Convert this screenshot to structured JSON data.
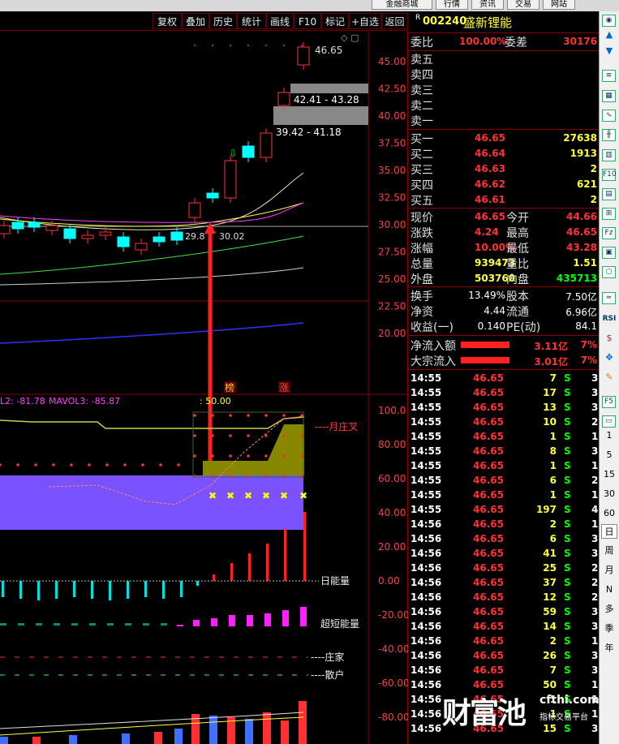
{
  "top_menu": [
    "金融商城",
    "行情",
    "资讯",
    "交易",
    "网站"
  ],
  "toolbar": [
    "复权",
    "叠加",
    "历史",
    "统计",
    "画线",
    "F10",
    "标记",
    "+自选",
    "返回"
  ],
  "stock": {
    "r_flag": "R",
    "code": "002240",
    "name": "盛新锂能"
  },
  "order_book": {
    "wei_bi_label": "委比",
    "wei_bi": "100.00%",
    "wei_cha_label": "委差",
    "wei_cha": "30176",
    "sells": [
      {
        "label": "卖五"
      },
      {
        "label": "卖四"
      },
      {
        "label": "卖三"
      },
      {
        "label": "卖二"
      },
      {
        "label": "卖一"
      }
    ],
    "buys": [
      {
        "label": "买一",
        "price": "46.65",
        "vol": "27638"
      },
      {
        "label": "买二",
        "price": "46.64",
        "vol": "1913"
      },
      {
        "label": "买三",
        "price": "46.63",
        "vol": "2"
      },
      {
        "label": "买四",
        "price": "46.62",
        "vol": "621"
      },
      {
        "label": "买五",
        "price": "46.61",
        "vol": "2"
      }
    ]
  },
  "quote": [
    {
      "l1": "现价",
      "v1": "46.65",
      "l2": "今开",
      "v2": "44.66"
    },
    {
      "l1": "涨跌",
      "v1": "4.24",
      "l2": "最高",
      "v2": "46.65"
    },
    {
      "l1": "涨幅",
      "v1": "10.00%",
      "l2": "最低",
      "v2": "43.28"
    },
    {
      "l1": "总量",
      "v1": "939473",
      "l2": "量比",
      "v2": "1.51"
    },
    {
      "l1": "外盘",
      "v1": "503760",
      "l2": "内盘",
      "v2": "435713"
    }
  ],
  "stats": [
    {
      "l1": "换手",
      "v1": "13.49%",
      "l2": "股本",
      "v2": "7.50亿"
    },
    {
      "l1": "净资",
      "v1": "4.44",
      "l2": "流通",
      "v2": "6.96亿"
    },
    {
      "l1": "收益(一)",
      "v1": "0.140",
      "l2": "PE(动)",
      "v2": "84.1"
    }
  ],
  "flows": [
    {
      "label": "净流入额",
      "value": "3.11亿",
      "pct": "7%"
    },
    {
      "label": "大宗流入",
      "value": "3.01亿",
      "pct": "7%"
    }
  ],
  "ticks": [
    [
      "14:55",
      "46.65",
      "7",
      "S",
      "3"
    ],
    [
      "14:55",
      "46.65",
      "17",
      "S",
      "3"
    ],
    [
      "14:55",
      "46.65",
      "13",
      "S",
      "3"
    ],
    [
      "14:55",
      "46.65",
      "10",
      "S",
      "2"
    ],
    [
      "14:55",
      "46.65",
      "1",
      "S",
      "1"
    ],
    [
      "14:55",
      "46.65",
      "8",
      "S",
      "3"
    ],
    [
      "14:55",
      "46.65",
      "1",
      "S",
      "1"
    ],
    [
      "14:55",
      "46.65",
      "6",
      "S",
      "2"
    ],
    [
      "14:55",
      "46.65",
      "1",
      "S",
      "1"
    ],
    [
      "14:55",
      "46.65",
      "197",
      "S",
      "4"
    ],
    [
      "14:56",
      "46.65",
      "2",
      "S",
      "1"
    ],
    [
      "14:56",
      "46.65",
      "6",
      "S",
      "3"
    ],
    [
      "14:56",
      "46.65",
      "41",
      "S",
      "3"
    ],
    [
      "14:56",
      "46.65",
      "25",
      "S",
      "2"
    ],
    [
      "14:56",
      "46.65",
      "37",
      "S",
      "2"
    ],
    [
      "14:56",
      "46.65",
      "12",
      "S",
      "2"
    ],
    [
      "14:56",
      "46.65",
      "59",
      "S",
      "3"
    ],
    [
      "14:56",
      "46.65",
      "14",
      "S",
      "3"
    ],
    [
      "14:56",
      "46.65",
      "2",
      "S",
      "1"
    ],
    [
      "14:56",
      "46.65",
      "26",
      "S",
      "3"
    ],
    [
      "14:56",
      "46.65",
      "7",
      "S",
      "3"
    ],
    [
      "14:56",
      "46.65",
      "50",
      "S",
      "1"
    ],
    [
      "14:56",
      "46.65",
      "1",
      "S",
      "1"
    ],
    [
      "14:56",
      "46.65",
      "1",
      "S",
      "1"
    ],
    [
      "14:56",
      "46.65",
      "15",
      "S",
      "3"
    ]
  ],
  "price_axis": [
    "45.00",
    "42.50",
    "40.00",
    "37.50",
    "35.00",
    "32.50",
    "30.00",
    "27.50",
    "25.00",
    "22.50",
    "20.00"
  ],
  "ind_axis": [
    "100.0",
    "80.00",
    "60.00",
    "40.00",
    "20.00",
    "0.00",
    "-20.00",
    "-40.00",
    "-60.00",
    "-80.00"
  ],
  "annotations": {
    "high": "46.65",
    "zone1": "42.41 - 43.28",
    "zone2": "39.42 - 41.18",
    "low_label": "29.8",
    "low_label2": "30.02",
    "bang": "榜",
    "zhang": "涨",
    "ind_header1": "L2: -81.78",
    "ind_header2": "MAVOL3: -85.87",
    "ind_header3": ": 50.00",
    "yue_zhuang": "----月庄叉",
    "ri_neng": "日能量",
    "chao_duan": "超短能量",
    "zhuang": "----庄家",
    "san": "----散户"
  },
  "side_tools": [
    "1",
    "5",
    "15",
    "30",
    "60",
    "日",
    "周",
    "月",
    "N",
    "多",
    "季",
    "年"
  ],
  "side_icons": [
    "F10",
    "Fz",
    "RSI"
  ],
  "watermark": {
    "cn": "财富池",
    "site": "cfthi.com",
    "sub": "指标交易平台"
  },
  "colors": {
    "up": "#ff3333",
    "down": "#00ffff",
    "yellow": "#ffff00",
    "accent": "#ff0000"
  }
}
